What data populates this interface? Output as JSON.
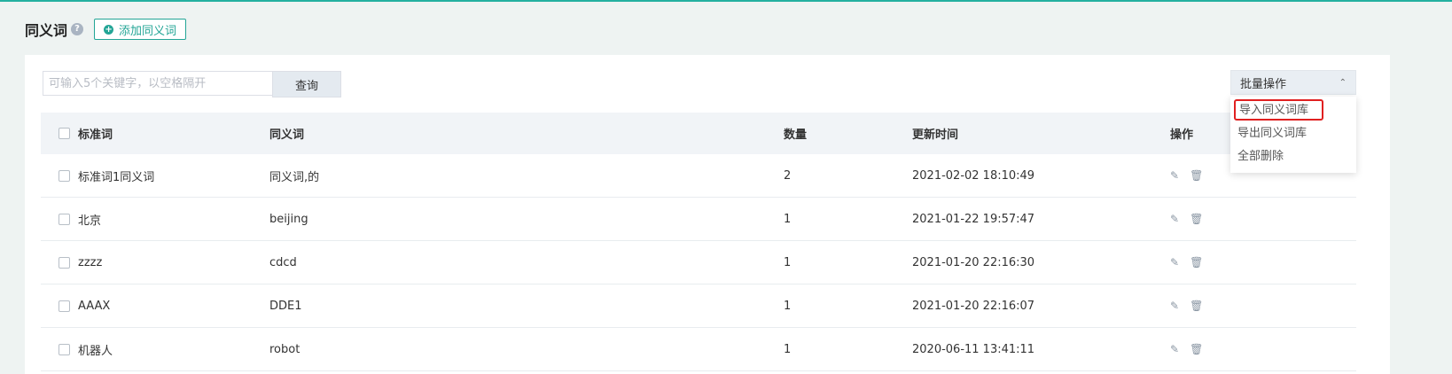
{
  "header": {
    "title": "同义词",
    "help_icon": "?",
    "add_button_label": "添加同义词"
  },
  "search": {
    "placeholder": "可输入5个关键字，以空格隔开",
    "value": "",
    "button_label": "查询"
  },
  "batch": {
    "label": "批量操作",
    "options": [
      "导入同义词库",
      "导出同义词库",
      "全部删除"
    ]
  },
  "table": {
    "columns": [
      "标准词",
      "同义词",
      "数量",
      "更新时间",
      "操作"
    ],
    "rows": [
      {
        "standard": "标准词1同义词",
        "synonyms": "同义词,的",
        "count": "2",
        "updated": "2021-02-02 18:10:49"
      },
      {
        "standard": "北京",
        "synonyms": "beijing",
        "count": "1",
        "updated": "2021-01-22 19:57:47"
      },
      {
        "standard": "zzzz",
        "synonyms": "cdcd",
        "count": "1",
        "updated": "2021-01-20 22:16:30"
      },
      {
        "standard": "AAAX",
        "synonyms": "DDE1",
        "count": "1",
        "updated": "2021-01-20 22:16:07"
      },
      {
        "standard": "机器人",
        "synonyms": "robot",
        "count": "1",
        "updated": "2020-06-11 13:41:11"
      }
    ]
  },
  "icons": {
    "edit": "edit-icon",
    "delete": "trash-icon"
  },
  "colors": {
    "accent": "#23a596",
    "highlight": "#e02020"
  }
}
